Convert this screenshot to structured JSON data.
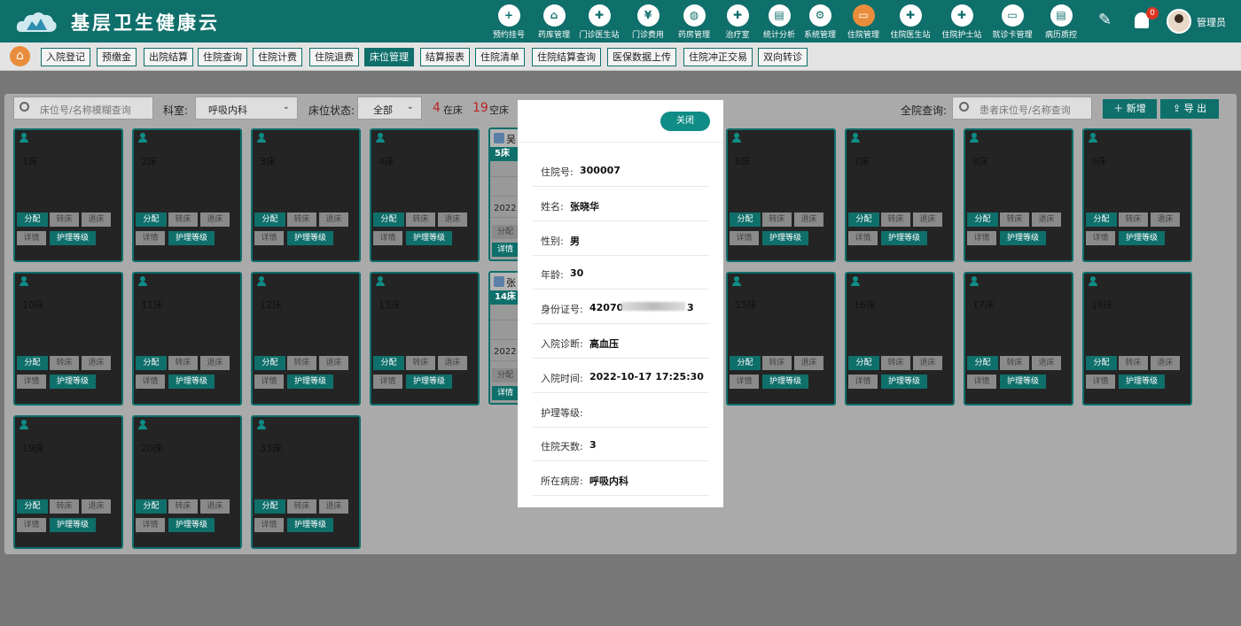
{
  "app": {
    "title": "基层卫生健康云"
  },
  "nav": [
    {
      "label": "预约挂号",
      "icon": "calendar-plus-icon",
      "glyph": "+"
    },
    {
      "label": "药库管理",
      "icon": "warehouse-icon",
      "glyph": "⌂"
    },
    {
      "label": "门诊医生站",
      "icon": "doctor-icon",
      "glyph": "✚"
    },
    {
      "label": "门诊费用",
      "icon": "yen-icon",
      "glyph": "¥"
    },
    {
      "label": "药房管理",
      "icon": "pill-icon",
      "glyph": "◍"
    },
    {
      "label": "治疗室",
      "icon": "nurse-icon",
      "glyph": "✚"
    },
    {
      "label": "统计分析",
      "icon": "bar-chart-icon",
      "glyph": "▤"
    },
    {
      "label": "系统管理",
      "icon": "gear-icon",
      "glyph": "⚙"
    },
    {
      "label": "住院管理",
      "icon": "bed-icon",
      "glyph": "▭",
      "active": true
    },
    {
      "label": "住院医生站",
      "icon": "doctor-icon",
      "glyph": "✚"
    },
    {
      "label": "住院护士站",
      "icon": "nurse-icon",
      "glyph": "✚"
    },
    {
      "label": "就诊卡管理",
      "icon": "card-icon",
      "glyph": "▭"
    },
    {
      "label": "病历质控",
      "icon": "document-icon",
      "glyph": "▤"
    }
  ],
  "user": {
    "name": "管理员",
    "notifications": "0"
  },
  "tabs": [
    {
      "label": "入院登记"
    },
    {
      "label": "预缴金"
    },
    {
      "label": "出院结算"
    },
    {
      "label": "住院查询"
    },
    {
      "label": "住院计费"
    },
    {
      "label": "住院退费"
    },
    {
      "label": "床位管理",
      "active": true
    },
    {
      "label": "结算报表"
    },
    {
      "label": "住院清单"
    },
    {
      "label": "住院结算查询"
    },
    {
      "label": "医保数据上传"
    },
    {
      "label": "住院冲正交易"
    },
    {
      "label": "双向转诊"
    }
  ],
  "filters": {
    "bed_search_placeholder": "床位号/名称模糊查询",
    "dept_label": "科室:",
    "dept_value": "呼吸内科",
    "status_label": "床位状态:",
    "status_value": "全部",
    "occupied_count": "4",
    "occupied_label": "在床",
    "empty_count": "19",
    "empty_label": "空床",
    "all_search_label": "全院查询:",
    "all_search_placeholder": "患者床位号/名称查询",
    "add_label": "新增",
    "export_label": "导 出"
  },
  "bed_actions": {
    "assign": "分配",
    "transfer": "转床",
    "discharge": "退床",
    "detail": "详情",
    "nursing": "护理等级"
  },
  "beds": [
    {
      "name": "1床"
    },
    {
      "name": "2床"
    },
    {
      "name": "3床"
    },
    {
      "name": "4床"
    },
    {
      "name": "6床"
    },
    {
      "name": "7床"
    },
    {
      "name": "8床"
    },
    {
      "name": "9床"
    },
    {
      "name": "10床"
    },
    {
      "name": "11床"
    },
    {
      "name": "12床"
    },
    {
      "name": "13床"
    },
    {
      "name": "15床"
    },
    {
      "name": "16床"
    },
    {
      "name": "17床"
    },
    {
      "name": "18床"
    },
    {
      "name": "19床"
    },
    {
      "name": "20床"
    },
    {
      "name": "33床"
    }
  ],
  "occupied": [
    {
      "name": "吴",
      "bed": "5床",
      "date": "2022",
      "assign": "分配",
      "detail": "详情"
    },
    {
      "name": "张",
      "bed": "14床",
      "date": "2022",
      "assign": "分配",
      "detail": "详情"
    }
  ],
  "modal": {
    "close_label": "关闭",
    "fields": [
      {
        "key": "住院号:",
        "value": "300007"
      },
      {
        "key": "姓名:",
        "value": "张晓华"
      },
      {
        "key": "性别:",
        "value": "男"
      },
      {
        "key": "年龄:",
        "value": "30"
      },
      {
        "key": "身份证号:",
        "value": "42070",
        "suffix": "3"
      },
      {
        "key": "入院诊断:",
        "value": "高血压"
      },
      {
        "key": "入院时间:",
        "value": "2022-10-17 17:25:30"
      },
      {
        "key": "护理等级:",
        "value": ""
      },
      {
        "key": "住院天数:",
        "value": "3"
      },
      {
        "key": "所在病房:",
        "value": "呼吸内科"
      }
    ]
  }
}
